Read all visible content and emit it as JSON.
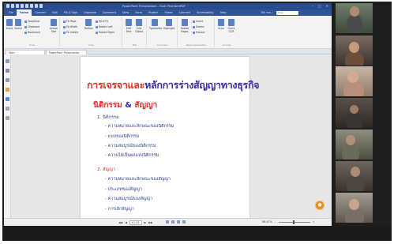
{
  "titlebar": {
    "title": "PowerPoint Presentation - Foxit PhantomPDF"
  },
  "menubar": {
    "tabs": [
      "File",
      "Home",
      "Convert",
      "Edit",
      "Fill & Sign",
      "Organize",
      "Comment",
      "View",
      "Form",
      "Protect",
      "Share",
      "Connect",
      "Accessibility",
      "Help"
    ],
    "active_tab": "Home",
    "tell_me": "Tell me...",
    "find_placeholder": "Find"
  },
  "ribbon": {
    "hand": "Hand",
    "select": "Select",
    "snapshot": "SnapShot",
    "clipboard": "Clipboard",
    "bookmark": "Bookmark",
    "actual_size": "Actual Size",
    "fit_page": "Fit Page",
    "fit_width": "Fit Width",
    "fit_visible": "Fit Visible",
    "reflow": "Reflow",
    "zoom_value": "66.67%",
    "rotate_left": "Rotate Left",
    "rotate_right": "Rotate Right",
    "edit_text": "Edit Text",
    "edit_object": "Edit Object",
    "typewriter": "Typewriter",
    "highlight": "Highlight",
    "rotate_pages": "Rotate Pages",
    "insert": "Insert",
    "delete": "Delete",
    "extract": "Extract",
    "scan": "Scan",
    "quick_ocr": "Quick OCR",
    "groups": [
      "Tools",
      "View",
      "Edit",
      "Comment",
      "Page Organization",
      "Convert"
    ]
  },
  "doctabs": {
    "start": "Start",
    "current": "PowerPoint Presentation"
  },
  "slide": {
    "title_part1": "การเจรจาและ",
    "title_part2": "หลักการร่างสัญญาทางธุรกิจ",
    "subtitle_part1": "นิติกรรม",
    "subtitle_amp": "&",
    "subtitle_part2": "สัญญา",
    "section1": "1. นิติกรรม",
    "section1_items": [
      "- ความหมายและลักษณะของนิติกรรม",
      "- แบบของนิติกรรม",
      "- ความสมบูรณ์ของนิติกรรม",
      "- ความไม่เป็นผลแห่งนิติกรรม"
    ],
    "section2": "2. สัญญา",
    "section2_items": [
      "- ความหมายและลักษณะของสัญญา",
      "- ประเภทของสัญญา",
      "- ความสมบูรณ์ของสัญญา",
      "- การเลิกสัญญา"
    ]
  },
  "statusbar": {
    "page_value": "4 / 41",
    "zoom_value": "66.67%"
  },
  "colors": {
    "title_red": "#e0322a",
    "title_blue": "#3b2fa8",
    "bullet_blue": "#2c3e8c",
    "ribbon_blue": "#2f5597"
  }
}
